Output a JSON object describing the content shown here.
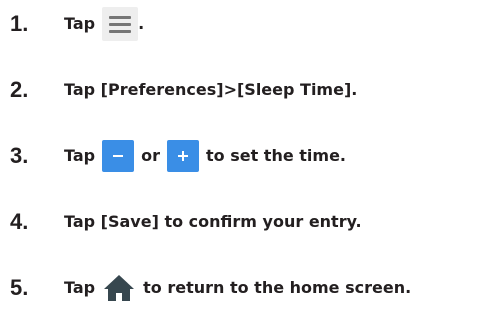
{
  "steps": [
    {
      "number": "1.",
      "text_a": "Tap",
      "text_b": "."
    },
    {
      "number": "2.",
      "text": "Tap [Preferences]>[Sleep Time]."
    },
    {
      "number": "3.",
      "text_a": "Tap",
      "text_b": "or",
      "text_c": "to set the time."
    },
    {
      "number": "4.",
      "text": "Tap [Save] to confirm your entry."
    },
    {
      "number": "5.",
      "text_a": "Tap",
      "text_b": "to return to the home screen."
    }
  ],
  "icons": {
    "menu": "menu-icon",
    "minus": "minus-icon",
    "plus": "plus-icon",
    "home": "home-icon"
  },
  "colors": {
    "text": "#231f20",
    "button_blue": "#3a8ee6",
    "menu_bg": "#eeeeee",
    "menu_bars": "#757575",
    "home_icon": "#37474f"
  }
}
